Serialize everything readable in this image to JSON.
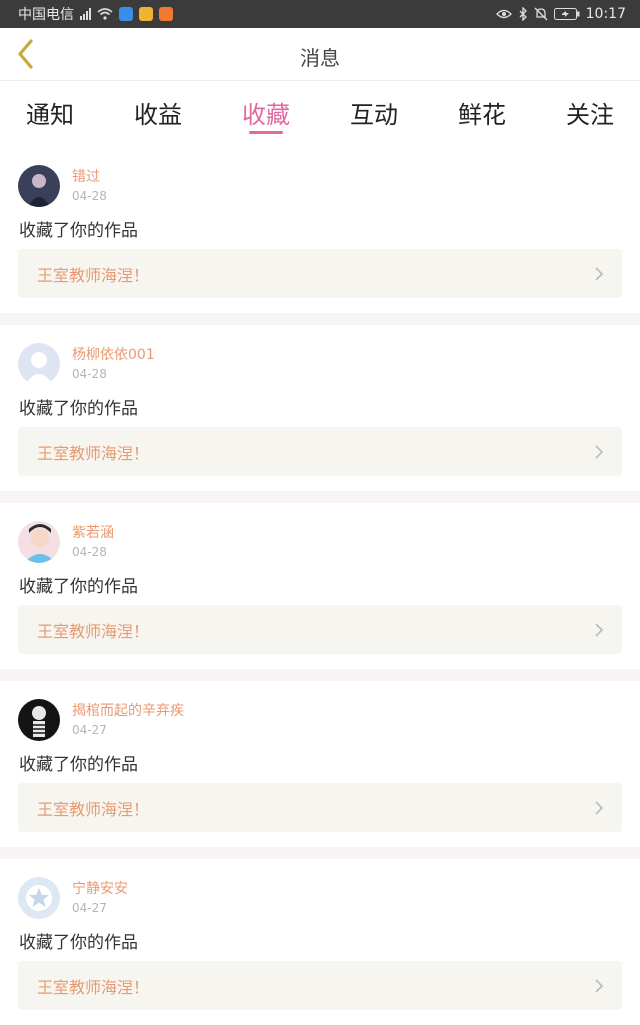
{
  "status_bar": {
    "carrier": "中国电信",
    "time": "10:17"
  },
  "header": {
    "title": "消息"
  },
  "tabs": [
    {
      "label": "通知",
      "active": false
    },
    {
      "label": "收益",
      "active": false
    },
    {
      "label": "收藏",
      "active": true
    },
    {
      "label": "互动",
      "active": false
    },
    {
      "label": "鲜花",
      "active": false
    },
    {
      "label": "关注",
      "active": false
    }
  ],
  "feed": [
    {
      "name": "错过",
      "date": "04-28",
      "action": "收藏了你的作品",
      "work": "王室教师海涅！"
    },
    {
      "name": "杨柳依依001",
      "date": "04-28",
      "action": "收藏了你的作品",
      "work": "王室教师海涅！"
    },
    {
      "name": "紫若涵",
      "date": "04-28",
      "action": "收藏了你的作品",
      "work": "王室教师海涅！"
    },
    {
      "name": "揭棺而起的辛弃疾",
      "date": "04-27",
      "action": "收藏了你的作品",
      "work": "王室教师海涅！"
    },
    {
      "name": "宁静安安",
      "date": "04-27",
      "action": "收藏了你的作品",
      "work": "王室教师海涅！"
    }
  ],
  "colors": {
    "accent": "#e06aa0",
    "username": "#e99a72",
    "work_bg": "#f6f5ef"
  }
}
